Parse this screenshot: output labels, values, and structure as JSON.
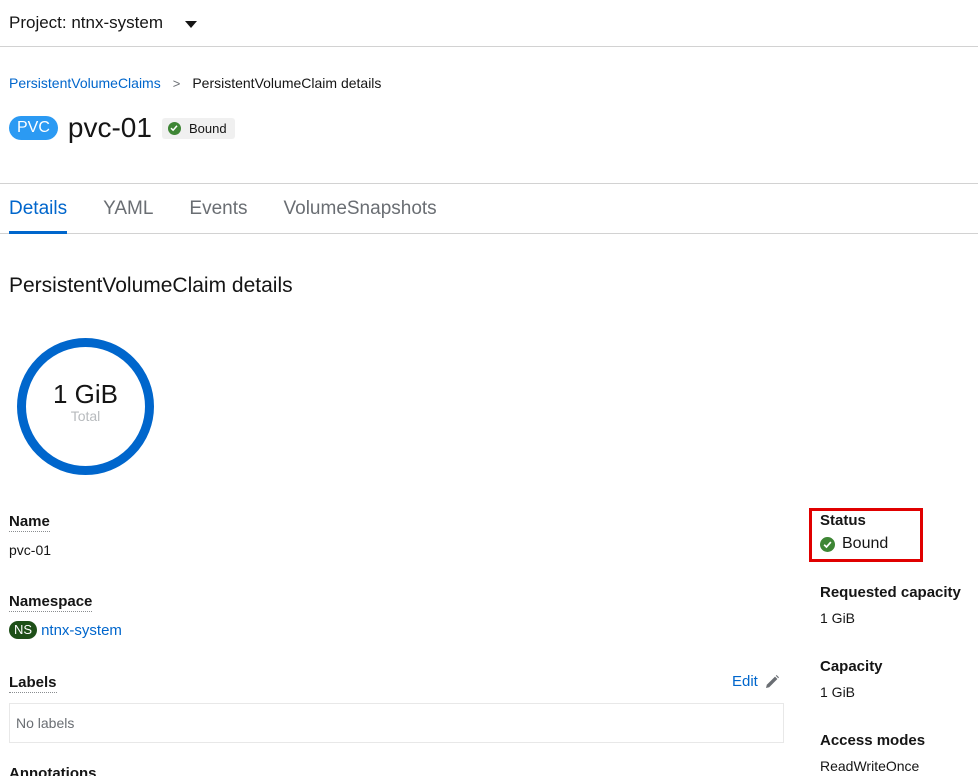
{
  "project": {
    "label": "Project: ntnx-system"
  },
  "breadcrumb": {
    "parent": "PersistentVolumeClaims",
    "separator": ">",
    "current": "PersistentVolumeClaim details"
  },
  "header": {
    "badge": "PVC",
    "title": "pvc-01",
    "status": "Bound"
  },
  "tabs": [
    {
      "label": "Details",
      "active": true
    },
    {
      "label": "YAML",
      "active": false
    },
    {
      "label": "Events",
      "active": false
    },
    {
      "label": "VolumeSnapshots",
      "active": false
    }
  ],
  "section_title": "PersistentVolumeClaim details",
  "donut": {
    "value": "1 GiB",
    "sublabel": "Total"
  },
  "fields": {
    "name_label": "Name",
    "name_value": "pvc-01",
    "namespace_label": "Namespace",
    "namespace_badge": "NS",
    "namespace_value": "ntnx-system",
    "labels_label": "Labels",
    "labels_edit": "Edit",
    "labels_empty": "No labels",
    "annotations_label": "Annotations"
  },
  "side": {
    "status_label": "Status",
    "status_value": "Bound",
    "requested_label": "Requested capacity",
    "requested_value": "1 GiB",
    "capacity_label": "Capacity",
    "capacity_value": "1 GiB",
    "access_label": "Access modes",
    "access_value": "ReadWriteOnce"
  },
  "colors": {
    "accent": "#0066cc",
    "success": "#3e8635",
    "highlight": "#e00000",
    "pvc_badge": "#2b9af3",
    "ns_badge": "#1e4f18",
    "donut": "#0066cc"
  },
  "icons": [
    "caret-down-icon",
    "chevron-right-icon",
    "check-circle-icon",
    "pencil-icon"
  ]
}
